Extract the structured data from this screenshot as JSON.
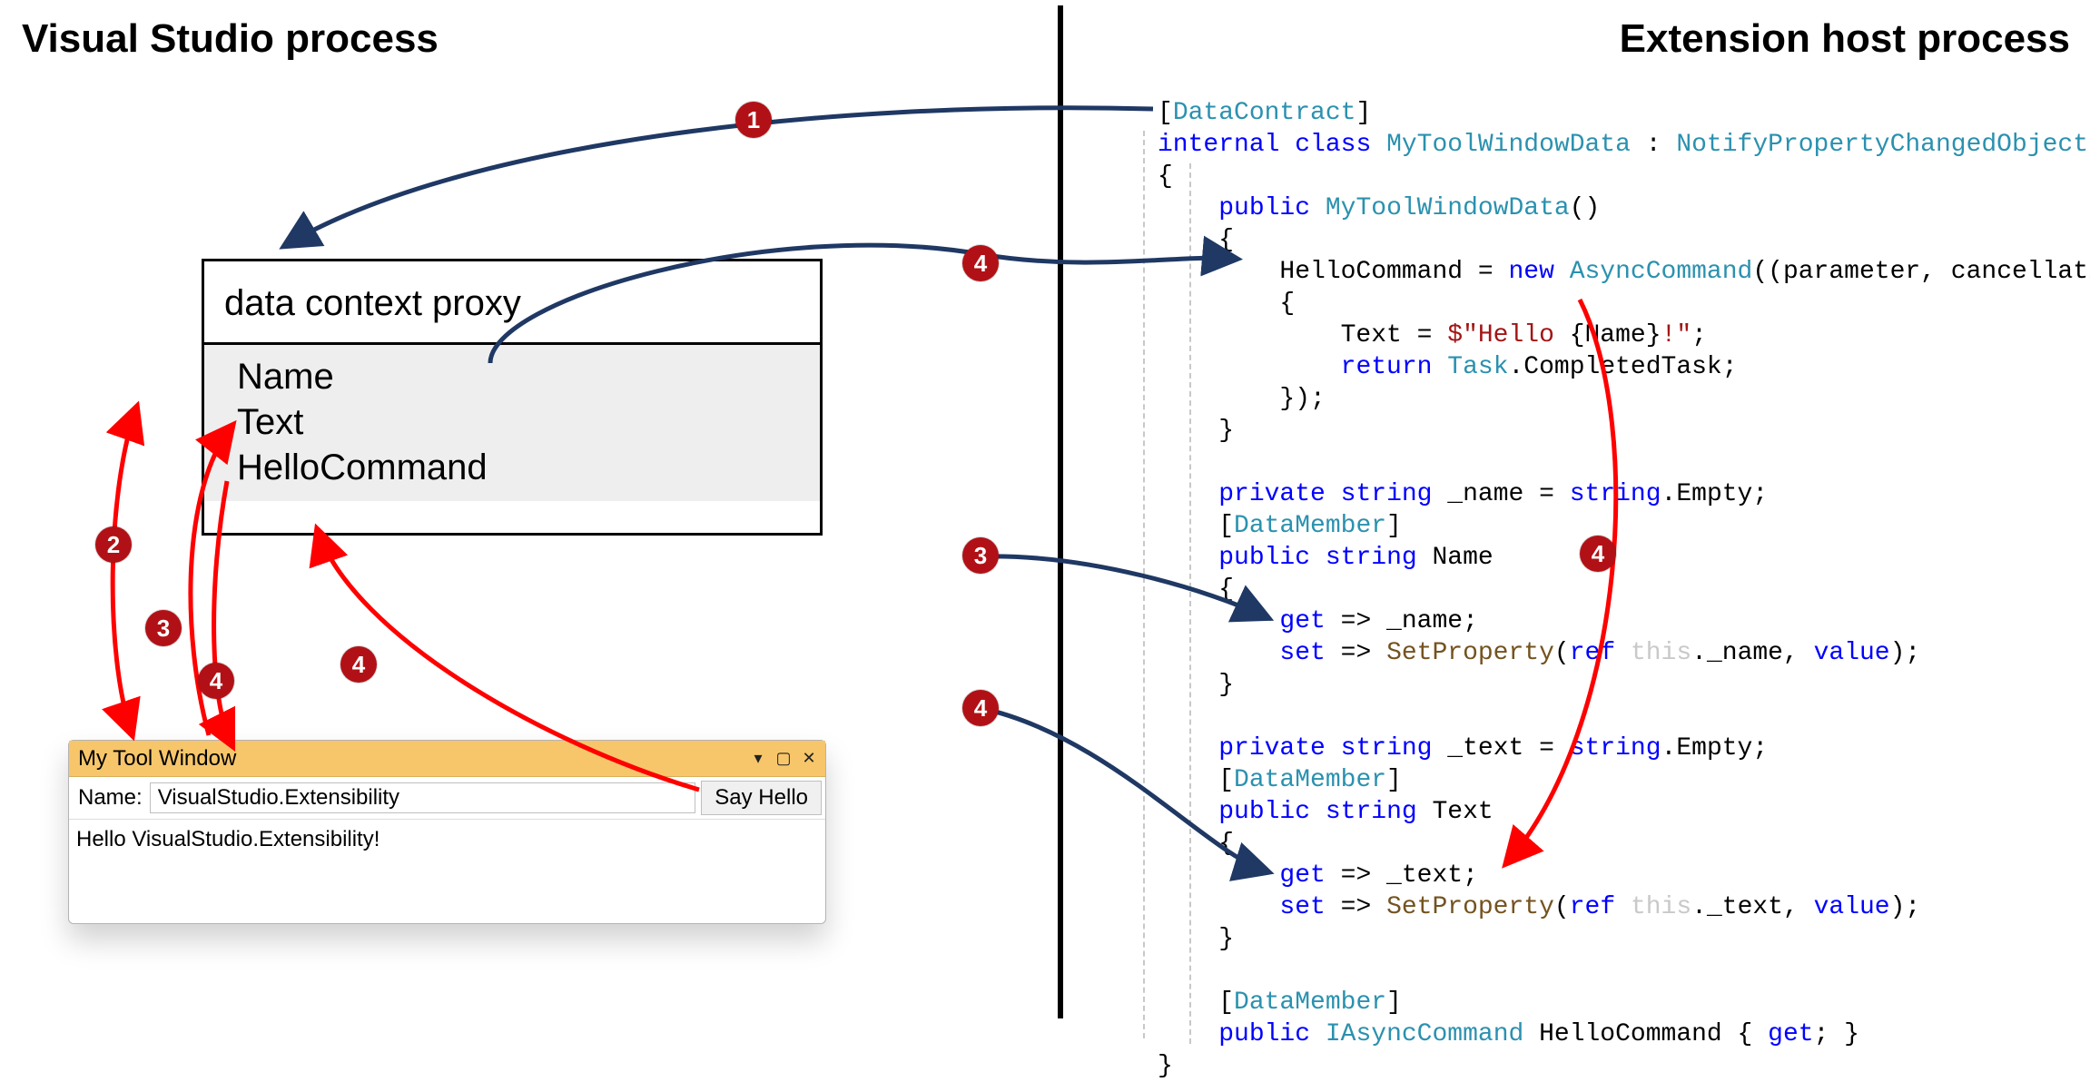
{
  "headings": {
    "left": "Visual Studio process",
    "right": "Extension host process"
  },
  "proxy": {
    "title": "data context proxy",
    "props": [
      "Name",
      "Text",
      "HelloCommand"
    ]
  },
  "tool_window": {
    "title": "My Tool Window",
    "name_label": "Name:",
    "name_value": "VisualStudio.Extensibility",
    "button_label": "Say Hello",
    "output_text": "Hello VisualStudio.Extensibility!"
  },
  "code": {
    "t01a": "[",
    "t01b": "DataContract",
    "t01c": "]",
    "t02a": "internal",
    "t02b": " ",
    "t02c": "class",
    "t02d": " ",
    "t02e": "MyToolWindowData",
    "t02f": " : ",
    "t02g": "NotifyPropertyChangedObject",
    "t03": "{",
    "t04a": "    ",
    "t04b": "public",
    "t04c": " ",
    "t04d": "MyToolWindowData",
    "t04e": "()",
    "t05": "    {",
    "t06a": "        HelloCommand = ",
    "t06b": "new",
    "t06c": " ",
    "t06d": "AsyncCommand",
    "t06e": "((parameter, cancellationToken) =>",
    "t07": "        {",
    "t08a": "            Text = ",
    "t08b": "$\"Hello ",
    "t08c": "{Name}",
    "t08d": "!\"",
    "t08e": ";",
    "t09a": "            ",
    "t09b": "return",
    "t09c": " ",
    "t09d": "Task",
    "t09e": ".CompletedTask;",
    "t10": "        });",
    "t11": "    }",
    "t12": "",
    "t13a": "    ",
    "t13b": "private",
    "t13c": " ",
    "t13d": "string",
    "t13e": " _name = ",
    "t13f": "string",
    "t13g": ".Empty;",
    "t14a": "    [",
    "t14b": "DataMember",
    "t14c": "]",
    "t15a": "    ",
    "t15b": "public",
    "t15c": " ",
    "t15d": "string",
    "t15e": " Name",
    "t16": "    {",
    "t17a": "        ",
    "t17b": "get",
    "t17c": " => _name;",
    "t18a": "        ",
    "t18b": "set",
    "t18c": " => ",
    "t18d": "SetProperty",
    "t18e": "(",
    "t18f": "ref",
    "t18g": " ",
    "t18h": "this",
    "t18i": "._name, ",
    "t18j": "value",
    "t18k": ");",
    "t19": "    }",
    "t20": "",
    "t21a": "    ",
    "t21b": "private",
    "t21c": " ",
    "t21d": "string",
    "t21e": " _text = ",
    "t21f": "string",
    "t21g": ".Empty;",
    "t22a": "    [",
    "t22b": "DataMember",
    "t22c": "]",
    "t23a": "    ",
    "t23b": "public",
    "t23c": " ",
    "t23d": "string",
    "t23e": " Text",
    "t24": "    {",
    "t25a": "        ",
    "t25b": "get",
    "t25c": " => _text;",
    "t26a": "        ",
    "t26b": "set",
    "t26c": " => ",
    "t26d": "SetProperty",
    "t26e": "(",
    "t26f": "ref",
    "t26g": " ",
    "t26h": "this",
    "t26i": "._text, ",
    "t26j": "value",
    "t26k": ");",
    "t27": "    }",
    "t28": "",
    "t29a": "    [",
    "t29b": "DataMember",
    "t29c": "]",
    "t30a": "    ",
    "t30b": "public",
    "t30c": " ",
    "t30d": "IAsyncCommand",
    "t30e": " HelloCommand { ",
    "t30f": "get",
    "t30g": "; }",
    "t31": "}"
  },
  "badges": {
    "b1": "1",
    "b2": "2",
    "b3": "3",
    "b4": "4"
  },
  "colors": {
    "badge": "#b11116",
    "arrow_blue": "#1f3864",
    "arrow_red": "#ff0000",
    "titlebar": "#f7c66b"
  }
}
